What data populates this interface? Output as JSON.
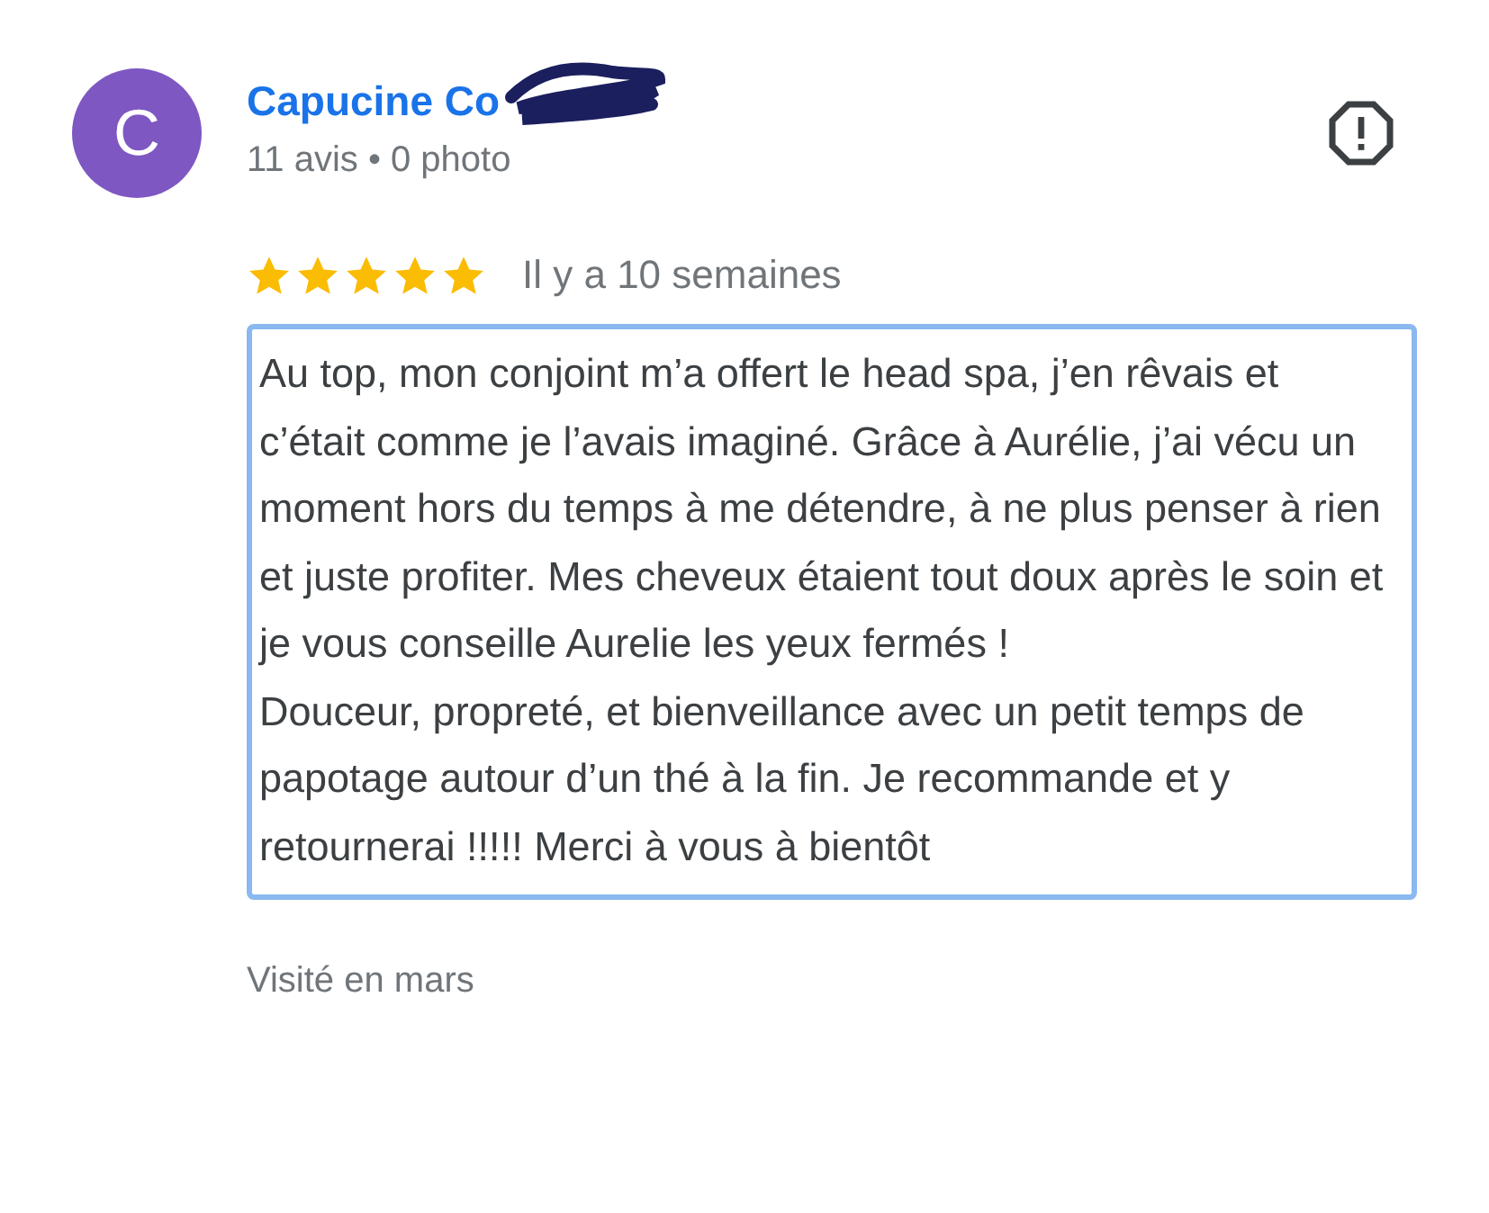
{
  "review": {
    "avatar_letter": "C",
    "author": "Capucine Co",
    "author_redacted": true,
    "meta": "11 avis • 0 photo",
    "stars": 5,
    "time": "Il y a 10 semaines",
    "text": "Au top, mon conjoint m’a offert le head spa, j’en rêvais et c’était comme je l’avais imaginé. Grâce à Aurélie, j’ai vécu un moment hors du temps à me détendre, à ne plus penser à rien et juste profiter. Mes cheveux étaient tout doux après le soin et je vous conseille Aurelie les yeux fermés !\nDouceur, propreté, et bienveillance avec un petit temps de papotage autour d’un thé à la fin. Je recommande et y retournerai !!!!! Merci à vous à bientôt",
    "text_selected": true,
    "visited": "Visité en mars"
  }
}
